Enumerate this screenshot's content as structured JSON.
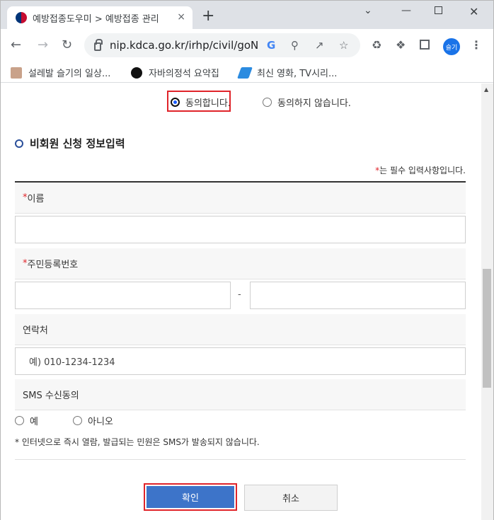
{
  "browser": {
    "tab_title": "예방접종도우미 > 예방접종 관리",
    "tab_close": "×",
    "new_tab": "+",
    "url": "nip.kdca.go.kr/irhp/civil/goN...",
    "profile_label": "슬기",
    "bookmarks": [
      {
        "label": "설레발 슬기의 일상..."
      },
      {
        "label": "자바의정석 요약집"
      },
      {
        "label": "최신 영화, TV시리..."
      }
    ]
  },
  "agreement": {
    "agree_label": "동의합니다.",
    "disagree_label": "동의하지 않습니다.",
    "selected": "agree"
  },
  "form": {
    "section_title": "비회원 신청 정보입력",
    "required_star": "*",
    "required_note": "는 필수 입력사항입니다.",
    "name_label": "이름",
    "name_value": "",
    "rrn_label": "주민등록번호",
    "rrn_front_value": "",
    "rrn_separator": "-",
    "rrn_back_value": "",
    "contact_label": "연락처",
    "contact_placeholder": "예) 010-1234-1234",
    "sms_label": "SMS 수신동의",
    "sms_yes": "예",
    "sms_no": "아니오",
    "notice": "* 인터넷으로 즉시 열람, 발급되는 민원은 SMS가 발송되지 않습니다."
  },
  "buttons": {
    "confirm": "확인",
    "cancel": "취소"
  },
  "colors": {
    "accent_blue": "#3d74c9",
    "highlight_red": "#e0242a",
    "required_star": "#e0242a"
  },
  "icons": {
    "back": "arrow-left-icon",
    "forward": "arrow-right-icon",
    "reload": "reload-icon",
    "lock": "lock-icon",
    "google": "google-icon",
    "zoom": "zoom-icon",
    "share": "share-icon",
    "bookmark_star": "star-icon",
    "recycle": "recycle-icon",
    "extensions": "puzzle-icon",
    "sidepanel": "side-panel-icon",
    "menu": "kebab-menu-icon"
  }
}
